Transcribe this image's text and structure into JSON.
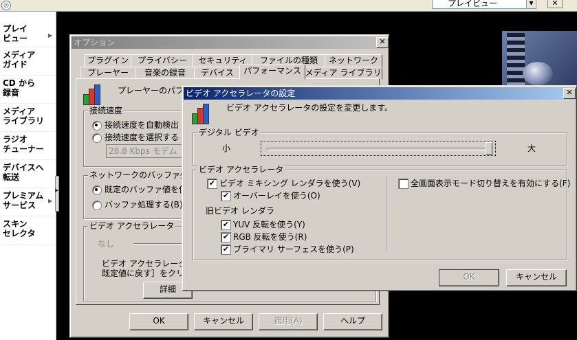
{
  "topbar": {
    "now_playing_combo": "プレイビュー",
    "close_symbol": "✕"
  },
  "taskbar": {
    "items": [
      {
        "label": "プレイ\nビュー",
        "has_arrow": true
      },
      {
        "label": "メディア\nガイド",
        "has_arrow": false
      },
      {
        "label": "CD から\n録音",
        "has_arrow": false
      },
      {
        "label": "メディア\nライブラリ",
        "has_arrow": false
      },
      {
        "label": "ラジオ\nチューナー",
        "has_arrow": false
      },
      {
        "label": "デバイスへ\n転送",
        "has_arrow": false
      },
      {
        "label": "プレミアム\nサービス",
        "has_arrow": true
      },
      {
        "label": "スキン\nセレクタ",
        "has_arrow": false
      }
    ],
    "arrow_symbol": "▶"
  },
  "options_dialog": {
    "title": "オプション",
    "tabs_row1": [
      "プラグイン",
      "プライバシー",
      "セキュリティ",
      "ファイルの種類",
      "ネットワーク"
    ],
    "tabs_row2": [
      "プレーヤー",
      "音楽の録音",
      "デバイス",
      "パフォーマンス",
      "メディア ライブラリ"
    ],
    "active_tab": "パフォーマンス",
    "header_text": "プレーヤーのパフォー",
    "connection": {
      "group_label": "接続速度",
      "auto_detect": "接続速度を自動検出",
      "select": "接続速度を選択する",
      "speed_value": "28.8 Kbps モデム"
    },
    "buffer": {
      "group_label": "ネットワークのバッファ処理",
      "default": "既定のバッファ値を使",
      "custom": "バッファ処理する(B):"
    },
    "video_accel": {
      "group_label": "ビデオ アクセラレータ",
      "none_label": "なし",
      "desc_line1": "ビデオ アクセラレータの［",
      "desc_line2": "既定値に戻す］をクリック",
      "details_button": "詳細"
    },
    "buttons": {
      "ok": "OK",
      "cancel": "キャンセル",
      "apply": "適用(A)",
      "help": "ヘルプ"
    }
  },
  "accel_dialog": {
    "title": "ビデオ アクセラレータの設定",
    "description": "ビデオ アクセラレータの設定を変更します。",
    "digital_video": {
      "group_label": "デジタル ビデオ",
      "min_label": "小",
      "max_label": "大",
      "slider_level": 1.0
    },
    "video_accel": {
      "group_label": "ビデオ アクセラレータ",
      "mixing_renderer": "ビデオ ミキシング レンダラを使う(V)",
      "overlay": "オーバーレイを使う(O)",
      "legacy_renderer_label": "旧ビデオ レンダラ",
      "yuv": "YUV 反転を使う(Y)",
      "rgb": "RGB 反転を使う(R)",
      "primary_surface": "プライマリ サーフェスを使う(P)",
      "fullscreen_switch": "全画面表示モード切り替えを有効にする(F)"
    },
    "checked_symbol": "✔",
    "buttons": {
      "ok": "OK",
      "cancel": "キャンセル"
    }
  }
}
